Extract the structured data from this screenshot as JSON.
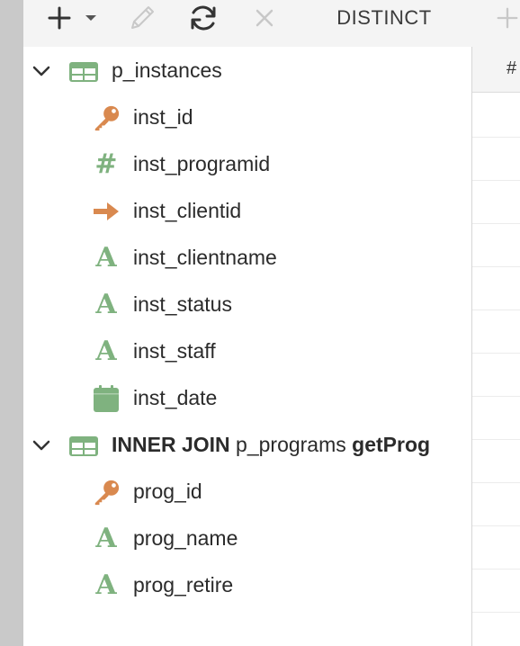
{
  "toolbar": {
    "add_icon": "plus-icon",
    "dropdown_icon": "caret-down-icon",
    "edit_icon": "pencil-icon",
    "refresh_icon": "refresh-icon",
    "close_icon": "x-icon",
    "distinct_label": "DISTINCT",
    "add2_icon": "plus-icon"
  },
  "colors": {
    "table_icon": "#7fb27f",
    "key_icon": "#d9894f",
    "field_icon": "#7fb27f",
    "arrow_icon": "#d9894f"
  },
  "tree": {
    "table1": {
      "name": "p_instances",
      "fields": [
        {
          "name": "inst_id",
          "icon": "key-icon"
        },
        {
          "name": "inst_programid",
          "icon": "hash-icon"
        },
        {
          "name": "inst_clientid",
          "icon": "arrow-right-icon"
        },
        {
          "name": "inst_clientname",
          "icon": "text-icon"
        },
        {
          "name": "inst_status",
          "icon": "text-icon"
        },
        {
          "name": "inst_staff",
          "icon": "text-icon"
        },
        {
          "name": "inst_date",
          "icon": "calendar-icon"
        }
      ]
    },
    "table2": {
      "join_prefix": "INNER JOIN",
      "name": "p_programs",
      "alias": "getProg",
      "fields": [
        {
          "name": "prog_id",
          "icon": "key-icon"
        },
        {
          "name": "prog_name",
          "icon": "text-icon"
        },
        {
          "name": "prog_retire",
          "icon": "text-icon"
        }
      ]
    }
  },
  "grid": {
    "header_label": "#"
  }
}
